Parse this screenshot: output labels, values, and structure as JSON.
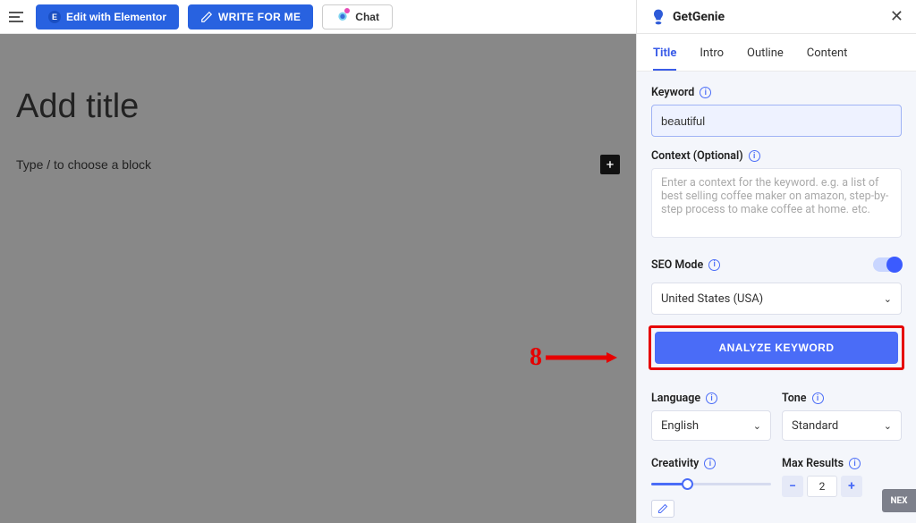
{
  "toolbar": {
    "elementor_label": "Edit with Elementor",
    "write_label": "WRITE FOR ME",
    "chat_label": "Chat"
  },
  "editor": {
    "title_placeholder": "Add title",
    "block_prompt_placeholder": "Type / to choose a block"
  },
  "panel": {
    "brand": "GetGenie",
    "tabs": [
      "Title",
      "Intro",
      "Outline",
      "Content"
    ],
    "active_tab": "Title",
    "keyword_label": "Keyword",
    "keyword_value": "beautiful",
    "context_label": "Context (Optional)",
    "context_placeholder": "Enter a context for the keyword. e.g. a list of best selling coffee maker on amazon, step-by-step process to make coffee at home. etc.",
    "seo_mode_label": "SEO Mode",
    "country_value": "United States (USA)",
    "analyze_label": "ANALYZE KEYWORD",
    "language_label": "Language",
    "language_value": "English",
    "tone_label": "Tone",
    "tone_value": "Standard",
    "creativity_label": "Creativity",
    "max_results_label": "Max Results",
    "max_results_value": "2",
    "next_label": "NEX"
  },
  "callout": {
    "number": "8"
  }
}
